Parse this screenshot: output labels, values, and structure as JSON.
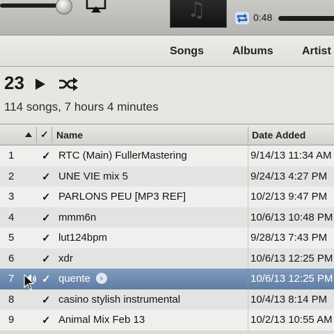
{
  "player": {
    "elapsed": "0:48"
  },
  "tabs": [
    {
      "label": "Songs"
    },
    {
      "label": "Albums"
    },
    {
      "label": "Artist"
    }
  ],
  "playlist": {
    "count": "23",
    "summary": "114 songs, 7 hours 4 minutes"
  },
  "columns": {
    "check": "✓",
    "name": "Name",
    "date_added": "Date Added"
  },
  "colors": {
    "selection": "#5f7ea5",
    "repeat_accent": "#1d5fb8"
  },
  "songs": [
    {
      "num": "1",
      "check": "✓",
      "name": "RTC (Main) FullerMastering",
      "date": "9/14/13 11:34 AM"
    },
    {
      "num": "2",
      "check": "✓",
      "name": "UNE VIE mix 5",
      "date": "9/24/13 4:27 PM"
    },
    {
      "num": "3",
      "check": "✓",
      "name": "PARLONS PEU [MP3 REF]",
      "date": "10/2/13 9:47 PM"
    },
    {
      "num": "4",
      "check": "✓",
      "name": "mmm6n",
      "date": "10/6/13 10:48 PM"
    },
    {
      "num": "5",
      "check": "✓",
      "name": "lut124bpm",
      "date": "9/28/13 7:43 PM"
    },
    {
      "num": "6",
      "check": "✓",
      "name": "xdr",
      "date": "10/6/13 12:25 PM"
    },
    {
      "num": "7",
      "check": "✓",
      "name": "quente",
      "date": "10/6/13 12:25 PM",
      "playing": true
    },
    {
      "num": "8",
      "check": "✓",
      "name": "casino stylish instrumental",
      "date": "10/4/13 8:14 PM"
    },
    {
      "num": "9",
      "check": "✓",
      "name": "Animal Mix Feb 13",
      "date": "10/2/13 10:55 AM"
    }
  ]
}
